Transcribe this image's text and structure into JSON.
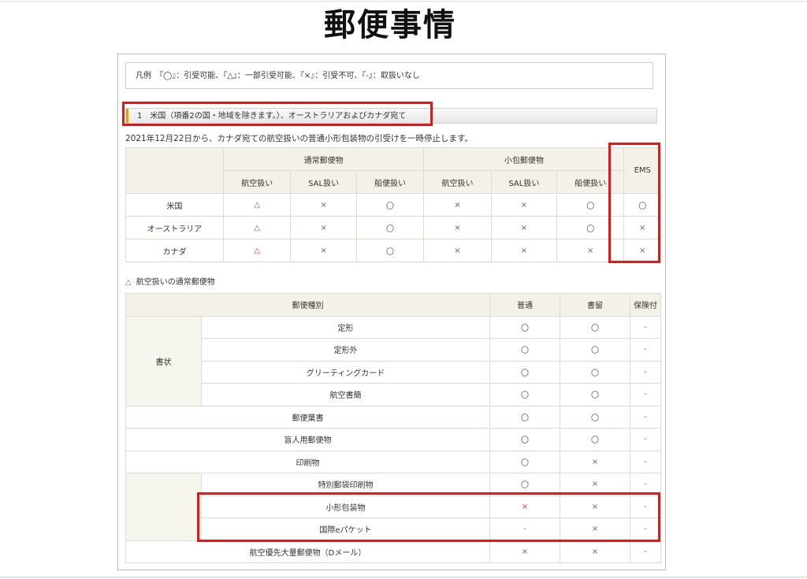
{
  "page_title": "郵便事情",
  "legend": "凡例　『◯』：引受可能、『△』：一部引受可能、『×』：引受不可、『-』：取扱いなし",
  "section_header": "1　米国（項番2の国・地域を除きます。）、オーストラリアおよびカナダ宛て",
  "notice": "2021年12月22日から、カナダ宛ての航空扱いの普通小形包装物の引受けを一時停止します。",
  "table1": {
    "group_regular": "通常郵便物",
    "group_parcel": "小包郵便物",
    "ems": "EMS",
    "sub": [
      "航空扱い",
      "SAL扱い",
      "船便扱い",
      "航空扱い",
      "SAL扱い",
      "船便扱い"
    ],
    "rows": [
      {
        "name": "米国",
        "cells": [
          "△",
          "×",
          "〇",
          "×",
          "×",
          "〇",
          "〇"
        ]
      },
      {
        "name": "オーストラリア",
        "cells": [
          "△",
          "×",
          "〇",
          "×",
          "×",
          "〇",
          "×"
        ]
      },
      {
        "name": "カナダ",
        "cells": [
          "△",
          "×",
          "〇",
          "×",
          "×",
          "×",
          "×"
        ]
      }
    ]
  },
  "subheading": {
    "symbol": "△",
    "text": "航空扱いの通常郵便物"
  },
  "table2": {
    "headers": [
      "郵便種別",
      "普通",
      "書留",
      "保険付"
    ],
    "shojo": "書状",
    "rows": [
      {
        "name": "定形",
        "cells": [
          "〇",
          "〇",
          "-"
        ]
      },
      {
        "name": "定形外",
        "cells": [
          "〇",
          "〇",
          "-"
        ]
      },
      {
        "name": "グリーティングカード",
        "cells": [
          "〇",
          "〇",
          "-"
        ]
      },
      {
        "name": "航空書簡",
        "cells": [
          "〇",
          "〇",
          "-"
        ]
      },
      {
        "name": "郵便葉書",
        "cells": [
          "〇",
          "〇",
          "-"
        ]
      },
      {
        "name": "盲人用郵便物",
        "cells": [
          "〇",
          "〇",
          "-"
        ]
      },
      {
        "name": "印刷物",
        "cells": [
          "〇",
          "×",
          "-"
        ]
      },
      {
        "name": "特別郵袋印刷物",
        "cells": [
          "〇",
          "×",
          "-"
        ]
      },
      {
        "name": "小形包装物",
        "cells": [
          "×",
          "×",
          "-"
        ]
      },
      {
        "name": "国際eパケット",
        "cells": [
          "-",
          "×",
          "-"
        ]
      },
      {
        "name": "航空優先大量郵便物（Dメール）",
        "cells": [
          "×",
          "×",
          "-"
        ]
      }
    ]
  },
  "colors": {
    "highlight": "#e01818",
    "header_bg": "#f4f2e8",
    "accent": "#e8a000"
  }
}
